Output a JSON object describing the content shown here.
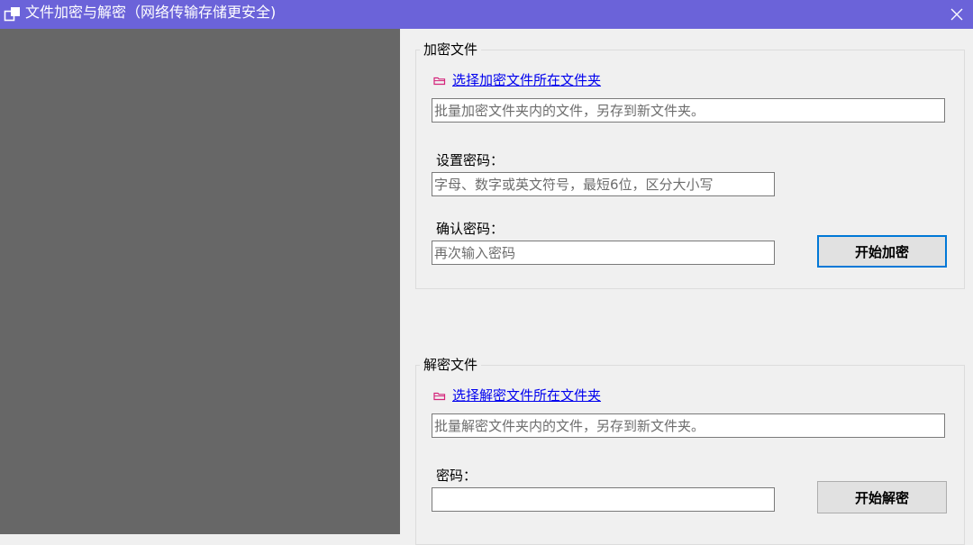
{
  "window": {
    "title": "文件加密与解密（网络传输存储更安全)",
    "app_icon": "windows-app-icon",
    "close_icon": "close-x-icon",
    "titlebar_color": "#6b63d9",
    "left_panel_color": "#676767"
  },
  "encrypt": {
    "group_title": "加密文件",
    "folder_link": "选择加密文件所在文件夹",
    "folder_icon": "folder-icon",
    "path_placeholder": "批量加密文件夹内的文件，另存到新文件夹。",
    "password_label": "设置密码：",
    "password_placeholder": "字母、数字或英文符号，最短6位，区分大小写",
    "confirm_label": "确认密码：",
    "confirm_placeholder": "再次输入密码",
    "start_button": "开始加密"
  },
  "decrypt": {
    "group_title": "解密文件",
    "folder_link": "选择解密文件所在文件夹",
    "folder_icon": "folder-icon",
    "path_placeholder": "批量解密文件夹内的文件，另存到新文件夹。",
    "password_label": "密码：",
    "password_value": "",
    "start_button": "开始解密"
  },
  "colors": {
    "link": "#0000ee",
    "folder_icon": "#d4237a",
    "focus_border": "#0078d7"
  }
}
